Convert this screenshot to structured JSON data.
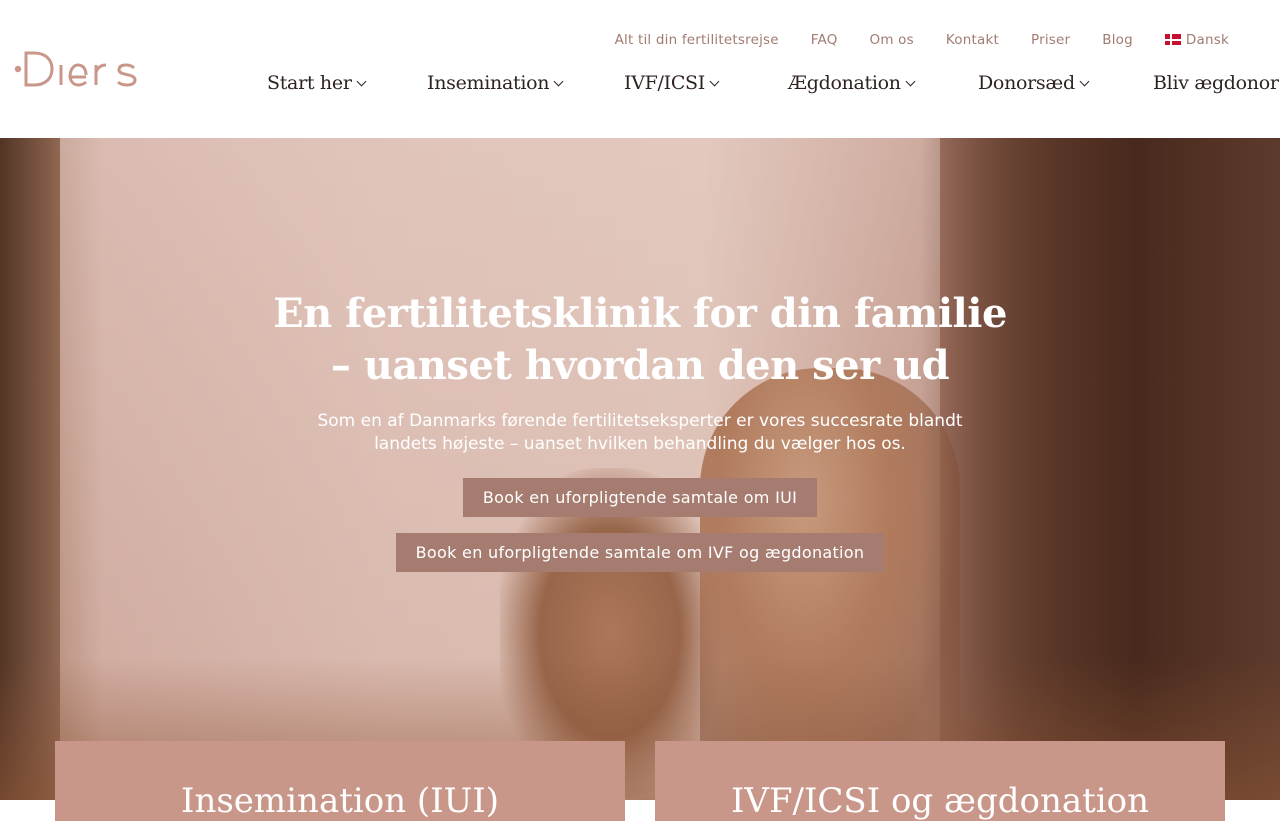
{
  "brand": {
    "logo_text": "Diers",
    "logo_color": "#c9978a"
  },
  "topnav": [
    {
      "label": "Alt til din fertilitetsrejse"
    },
    {
      "label": "FAQ"
    },
    {
      "label": "Om os"
    },
    {
      "label": "Kontakt"
    },
    {
      "label": "Priser"
    },
    {
      "label": "Blog"
    },
    {
      "label": "Dansk",
      "icon": "denmark-flag-icon"
    }
  ],
  "mainnav": [
    {
      "label": "Start her",
      "has_dropdown": true
    },
    {
      "label": "Insemination",
      "has_dropdown": true
    },
    {
      "label": "IVF/ICSI",
      "has_dropdown": true
    },
    {
      "label": "Ægdonation",
      "has_dropdown": true
    },
    {
      "label": "Donorsæd",
      "has_dropdown": true
    },
    {
      "label": "Bliv ægdonor",
      "has_dropdown": false
    }
  ],
  "hero": {
    "title_line1": "En fertilitetsklinik for din familie",
    "title_line2": "– uanset hvordan den ser ud",
    "subtitle": "Som en af Danmarks førende fertilitetseksperter er vores succesrate blandt landets højeste – uanset hvilken behandling du vælger hos os.",
    "button1": "Book en uforpligtende samtale om IUI",
    "button2": "Book en uforpligtende samtale om IVF og ægdonation"
  },
  "cards": [
    {
      "title": "Insemination (IUI)"
    },
    {
      "title": "IVF/ICSI og ægdonation"
    }
  ],
  "colors": {
    "accent": "#a67c70",
    "card": "#c9978a",
    "nav_link": "#a27c71",
    "text_dark": "#2e2320"
  }
}
